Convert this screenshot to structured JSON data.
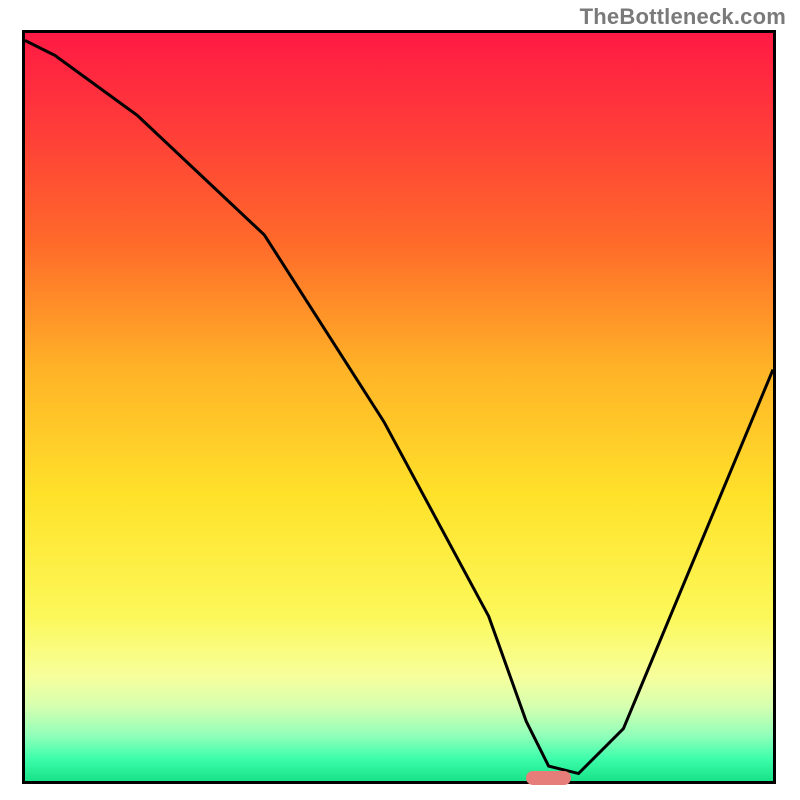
{
  "watermark": "TheBottleneck.com",
  "chart_data": {
    "type": "line",
    "title": "",
    "xlabel": "",
    "ylabel": "",
    "xlim": [
      0,
      100
    ],
    "ylim": [
      0,
      100
    ],
    "gradient_stops": [
      {
        "offset": 0,
        "color": "#ff1a44"
      },
      {
        "offset": 12,
        "color": "#ff3a3a"
      },
      {
        "offset": 28,
        "color": "#ff6a2a"
      },
      {
        "offset": 45,
        "color": "#ffb327"
      },
      {
        "offset": 62,
        "color": "#ffe22a"
      },
      {
        "offset": 78,
        "color": "#fcf85a"
      },
      {
        "offset": 86,
        "color": "#f7ff9c"
      },
      {
        "offset": 90,
        "color": "#d6ffb0"
      },
      {
        "offset": 94,
        "color": "#8fffb9"
      },
      {
        "offset": 97,
        "color": "#3dfdab"
      },
      {
        "offset": 100,
        "color": "#18e389"
      }
    ],
    "series": [
      {
        "name": "bottleneck-curve",
        "x": [
          0,
          4,
          15,
          32,
          48,
          62,
          67,
          70,
          74,
          80,
          100
        ],
        "values": [
          99,
          97,
          89,
          73,
          48,
          22,
          8,
          2,
          1,
          7,
          55
        ]
      }
    ],
    "marker": {
      "x": 70,
      "y": 0,
      "width": 6
    }
  },
  "colors": {
    "curve": "#000000",
    "marker": "#e77d78",
    "frame": "#000000"
  }
}
